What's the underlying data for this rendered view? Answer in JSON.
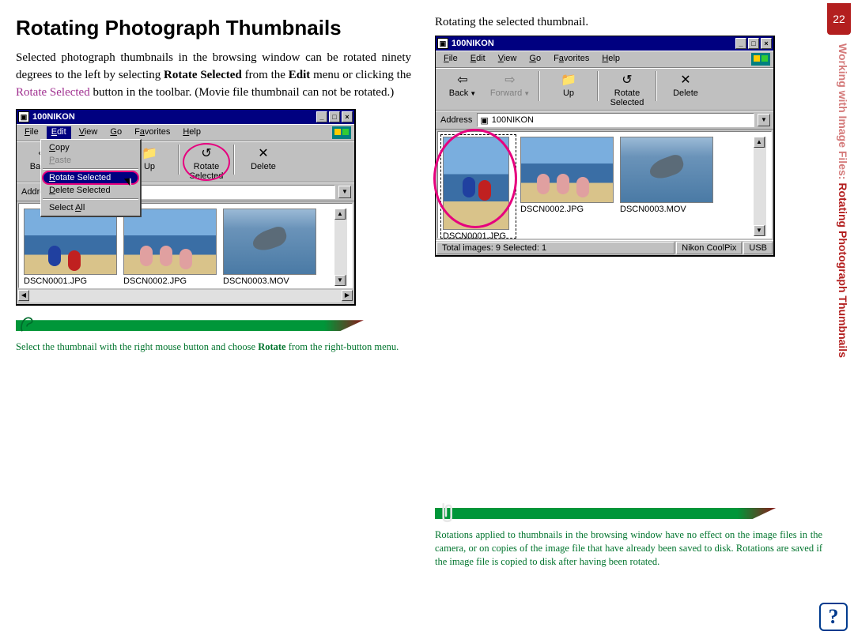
{
  "page_number": "22",
  "sidebar": {
    "light": "Working with Image Files: ",
    "dark": "Rotating Photograph Thumbnails"
  },
  "left": {
    "heading": "Rotating Photograph Thumbnails",
    "p1a": "Selected photograph thumbnails in the browsing window can be rotated ninety degrees to the left by selecting ",
    "p1b": "Rotate Selected",
    "p1c": " from the ",
    "p1d": "Edit",
    "p1e": " menu or clicking the ",
    "p1f": "Rotate Selected",
    "p1g": " button in the toolbar.  (Movie file thumbnail can not be rotated.)",
    "tip1a": "Select the thumbnail with the right mouse button and choose ",
    "tip1b": "Rotate",
    "tip1c": " from the right-button menu."
  },
  "right": {
    "caption": "Rotating the selected thumbnail.",
    "note": "Rotations applied to thumbnails in the browsing window have no effect on the image files in the camera, or on copies of the image file that have already been saved to disk.  Rotations are saved if the image file is copied to disk after having been rotated."
  },
  "win": {
    "title": "100NIKON",
    "menus": {
      "file": "File",
      "edit": "Edit",
      "view": "View",
      "go": "Go",
      "favorites": "Favorites",
      "help": "Help"
    },
    "dropdown": {
      "copy": "Copy",
      "paste": "Paste",
      "rotate_selected": "Rotate Selected",
      "delete_selected": "Delete Selected",
      "select_all": "Select All"
    },
    "toolbar": {
      "back": "Back",
      "forward": "Forward",
      "up": "Up",
      "rotate": "Rotate",
      "rotate2": "Selected",
      "delete": "Delete"
    },
    "address_label": "Address",
    "address_value": "100NIKON",
    "thumbs": [
      {
        "name": "DSCN0001.JPG"
      },
      {
        "name": "DSCN0002.JPG"
      },
      {
        "name": "DSCN0003.MOV"
      }
    ],
    "status": {
      "total": "Total images: 9   Selected: 1",
      "device": "Nikon CoolPix",
      "conn": "USB"
    }
  },
  "help_badge": "?"
}
